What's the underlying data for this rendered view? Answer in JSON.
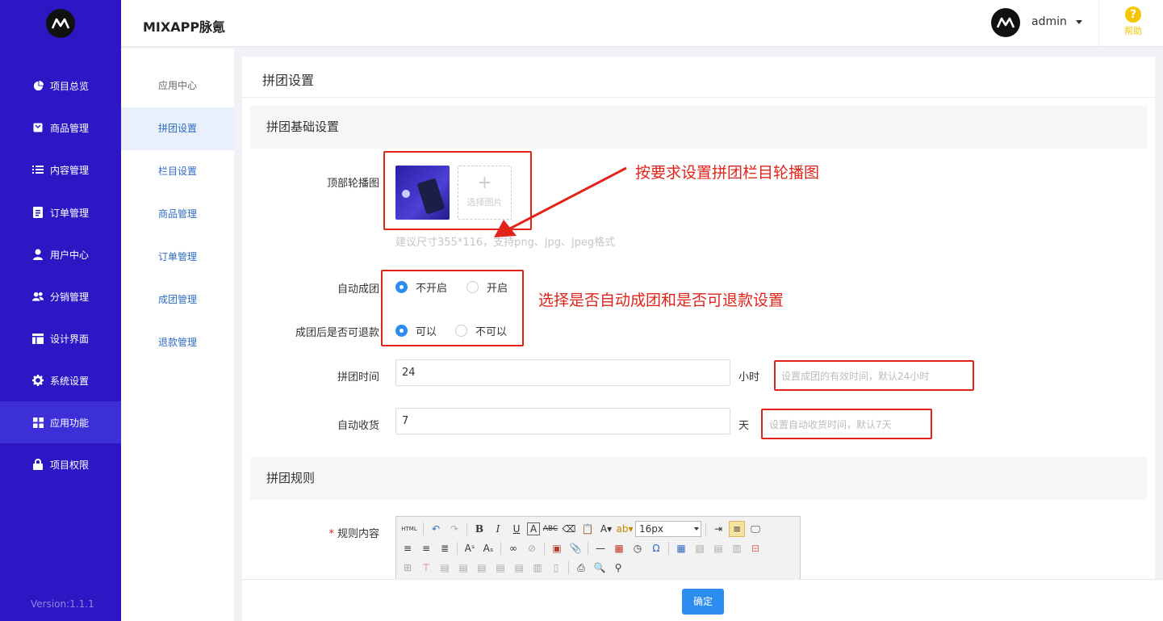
{
  "app": {
    "brand": "MIXAPP脉氪",
    "version": "Version:1.1.1"
  },
  "header": {
    "username": "admin",
    "help": "帮助"
  },
  "nav": {
    "items": [
      {
        "label": "项目总览",
        "icon": "pie-chart-icon"
      },
      {
        "label": "商品管理",
        "icon": "box-icon"
      },
      {
        "label": "内容管理",
        "icon": "list-icon"
      },
      {
        "label": "订单管理",
        "icon": "document-icon"
      },
      {
        "label": "用户中心",
        "icon": "user-icon"
      },
      {
        "label": "分销管理",
        "icon": "users-icon"
      },
      {
        "label": "设计界面",
        "icon": "layout-icon"
      },
      {
        "label": "系统设置",
        "icon": "gear-icon"
      },
      {
        "label": "应用功能",
        "icon": "grid-icon"
      },
      {
        "label": "项目权限",
        "icon": "lock-icon"
      }
    ],
    "active": "应用功能"
  },
  "subnav": {
    "items": [
      "应用中心",
      "拼团设置",
      "栏目设置",
      "商品管理",
      "订单管理",
      "成团管理",
      "退款管理"
    ],
    "active": "拼团设置"
  },
  "page": {
    "title": "拼团设置",
    "section_basic": "拼团基础设置",
    "section_rules": "拼团规则",
    "carousel": {
      "label": "顶部轮播图",
      "upload_label": "选择图片",
      "hint": "建议尺寸355*116，支持png、jpg、jpeg格式"
    },
    "auto_group": {
      "label": "自动成团",
      "options": [
        "不开启",
        "开启"
      ],
      "selected": "不开启"
    },
    "refund": {
      "label": "成团后是否可退款",
      "options": [
        "可以",
        "不可以"
      ],
      "selected": "可以"
    },
    "group_time": {
      "label": "拼团时间",
      "value": "24",
      "unit": "小时",
      "hint": "设置成团的有效时间，默认24小时"
    },
    "auto_receive": {
      "label": "自动收货",
      "value": "7",
      "unit": "天",
      "hint": "设置自动收货时间，默认7天"
    },
    "rules": {
      "label": "规则内容",
      "font_size": "16px"
    },
    "confirm": "确定"
  },
  "annotations": {
    "carousel": "按要求设置拼团栏目轮播图",
    "radios": "选择是否自动成团和是否可退款设置"
  },
  "colors": {
    "nav_bg": "#2d16c4",
    "accent": "#2d8cf0",
    "annotation": "#e2231a",
    "help": "#f5c600"
  }
}
